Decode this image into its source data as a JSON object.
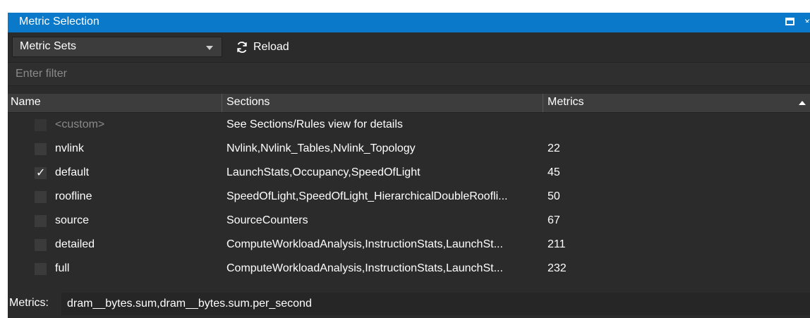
{
  "window": {
    "title": "Metric Selection"
  },
  "toolbar": {
    "metric_sets_value": "Metric Sets",
    "reload_label": "Reload"
  },
  "filter": {
    "placeholder": "Enter filter",
    "value": ""
  },
  "table": {
    "columns": [
      "Name",
      "Sections",
      "Metrics"
    ],
    "rows": [
      {
        "checked": false,
        "disabled": true,
        "name": "<custom>",
        "sections": "See Sections/Rules view for details",
        "metrics": ""
      },
      {
        "checked": false,
        "disabled": false,
        "name": "nvlink",
        "sections": "Nvlink,Nvlink_Tables,Nvlink_Topology",
        "metrics": "22"
      },
      {
        "checked": true,
        "disabled": false,
        "name": "default",
        "sections": "LaunchStats,Occupancy,SpeedOfLight",
        "metrics": "45"
      },
      {
        "checked": false,
        "disabled": false,
        "name": "roofline",
        "sections": "SpeedOfLight,SpeedOfLight_HierarchicalDoubleRoofli...",
        "metrics": "50"
      },
      {
        "checked": false,
        "disabled": false,
        "name": "source",
        "sections": "SourceCounters",
        "metrics": "67"
      },
      {
        "checked": false,
        "disabled": false,
        "name": "detailed",
        "sections": "ComputeWorkloadAnalysis,InstructionStats,LaunchSt...",
        "metrics": "211"
      },
      {
        "checked": false,
        "disabled": false,
        "name": "full",
        "sections": "ComputeWorkloadAnalysis,InstructionStats,LaunchSt...",
        "metrics": "232"
      }
    ]
  },
  "footer": {
    "label": "Metrics:",
    "value": "dram__bytes.sum,dram__bytes.sum.per_second"
  },
  "icons": {
    "reload": "reload-icon",
    "dropdown": "chevron-down-icon",
    "restore": "restore-window-icon",
    "close": "close-icon",
    "sort": "sort-ascending-icon"
  },
  "colors": {
    "accent": "#0a79c9",
    "background": "#2b2b2b",
    "header": "#3d3d3d"
  }
}
